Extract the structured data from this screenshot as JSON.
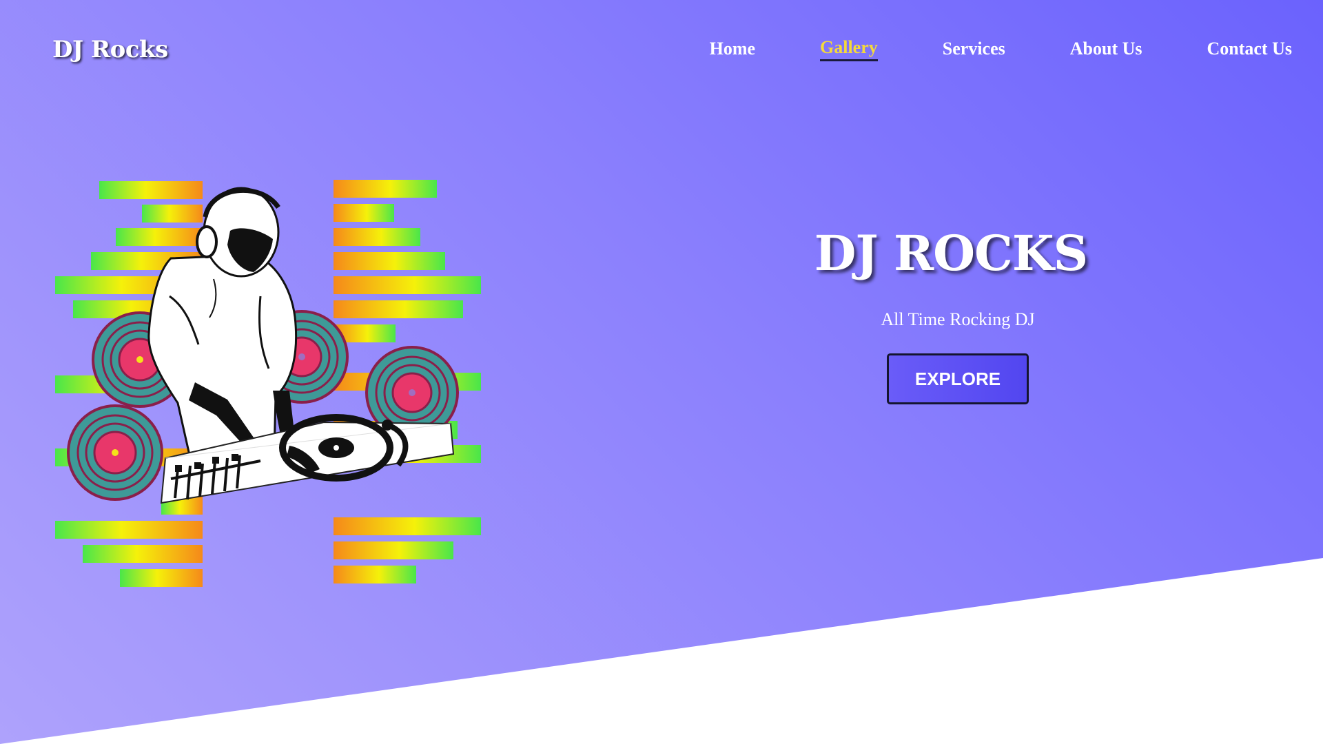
{
  "site": {
    "logo": "DJ Rocks"
  },
  "nav": {
    "items": [
      {
        "label": "Home",
        "active": false
      },
      {
        "label": "Gallery",
        "active": true
      },
      {
        "label": "Services",
        "active": false
      },
      {
        "label": "About Us",
        "active": false
      },
      {
        "label": "Contact Us",
        "active": false
      }
    ],
    "active_color": "#f4d93a"
  },
  "hero": {
    "title": "DJ ROCKS",
    "subtitle": "All Time Rocking DJ",
    "cta_label": "EXPLORE",
    "illustration": "dj-turntable-illustration"
  },
  "colors": {
    "gradient_start": "#6b62fd",
    "gradient_end": "#aea2fc",
    "button": "#5a4ef5"
  }
}
